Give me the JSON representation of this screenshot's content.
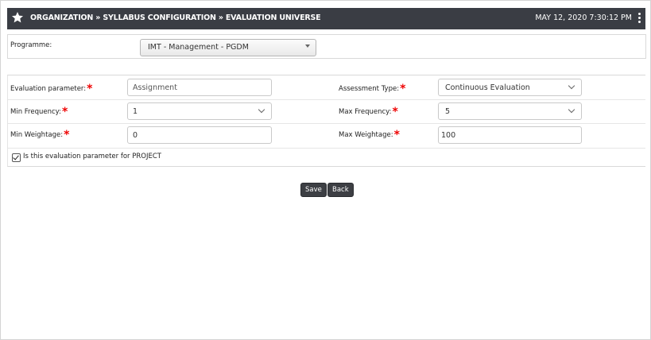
{
  "header": {
    "breadcrumb": "ORGANIZATION » SYLLABUS CONFIGURATION » EVALUATION UNIVERSE",
    "datetime": "MAY 12, 2020  7:30:12 PM",
    "icon": "star-icon",
    "menu_icon": "kebab-menu-icon"
  },
  "programme": {
    "label": "Programme:",
    "selected": "IMT - Management - PGDM"
  },
  "form": {
    "eval_param_label": "Evaluation parameter:",
    "eval_param_value": "Assignment",
    "assessment_type_label": "Assessment Type:",
    "assessment_type_value": "Continuous Evaluation",
    "min_freq_label": "Min Frequency:",
    "min_freq_value": "1",
    "max_freq_label": "Max Frequency:",
    "max_freq_value": "5",
    "min_weight_label": "Min Weightage:",
    "min_weight_value": "0",
    "max_weight_label": "Max Weightage:",
    "max_weight_value": "100",
    "required_marker": "*",
    "project_checkbox_label": "Is this evaluation parameter for PROJECT",
    "project_checked": true
  },
  "actions": {
    "save_label": "Save",
    "back_label": "Back"
  },
  "colors": {
    "header_bg": "#3a3d44",
    "required": "#ee0000",
    "button_bg": "#3d3f44"
  }
}
